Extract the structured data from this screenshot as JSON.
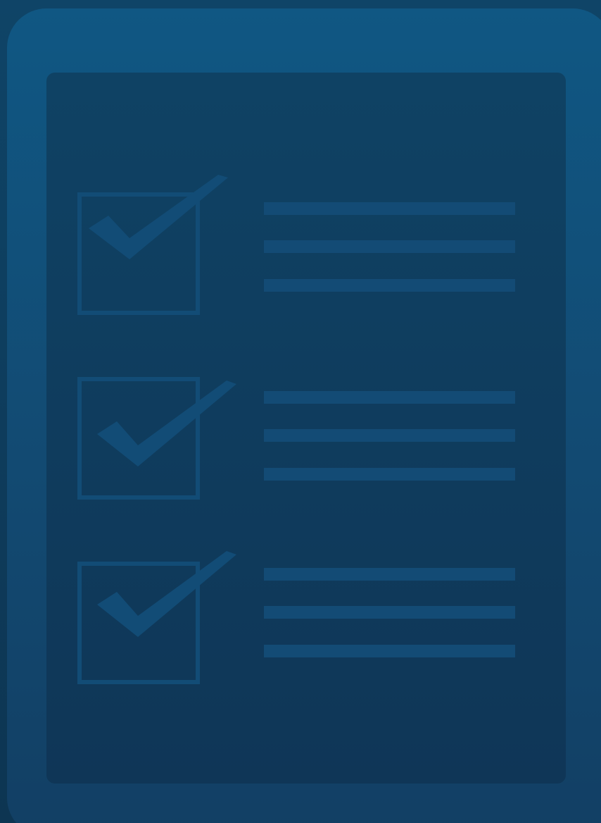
{
  "illustration": {
    "name": "checklist-clipboard",
    "colors": {
      "background": "#0e3c5e",
      "frame": "#105783",
      "panel": "#0f3f61",
      "marks": "#134b75"
    },
    "items": [
      {
        "checked": true,
        "icon": "checkmark-icon"
      },
      {
        "checked": true,
        "icon": "checkmark-icon"
      },
      {
        "checked": true,
        "icon": "checkmark-icon"
      }
    ]
  }
}
